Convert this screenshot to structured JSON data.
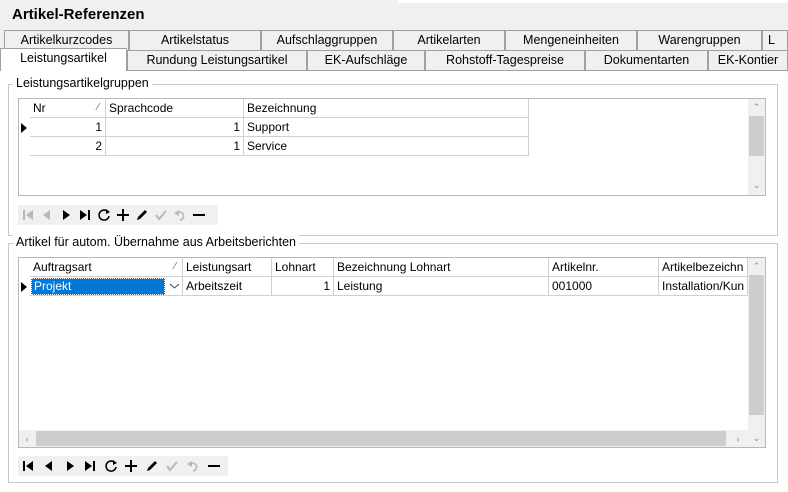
{
  "window": {
    "title": "Artikel-Referenzen"
  },
  "tabs_row1": [
    {
      "label": "Artikelkurzcodes"
    },
    {
      "label": "Artikelstatus"
    },
    {
      "label": "Aufschlaggruppen"
    },
    {
      "label": "Artikelarten"
    },
    {
      "label": "Mengeneinheiten"
    },
    {
      "label": "Warengruppen"
    },
    {
      "label": "L"
    }
  ],
  "tabs_row2": [
    {
      "label": "Leistungsartikel",
      "active": true
    },
    {
      "label": "Rundung Leistungsartikel"
    },
    {
      "label": "EK-Aufschläge"
    },
    {
      "label": "Rohstoff-Tagespreise"
    },
    {
      "label": "Dokumentarten"
    },
    {
      "label": "EK-Kontier"
    }
  ],
  "group1": {
    "title": "Leistungsartikelgruppen",
    "columns": [
      "Nr",
      "Sprachcode",
      "Bezeichnung"
    ],
    "rows": [
      {
        "nr": "1",
        "sprachcode": "1",
        "bezeichnung": "Support"
      },
      {
        "nr": "2",
        "sprachcode": "1",
        "bezeichnung": "Service"
      }
    ]
  },
  "group2": {
    "title": "Artikel für autom. Übernahme aus Arbeitsberichten",
    "columns": [
      "Auftragsart",
      "Leistungsart",
      "Lohnart",
      "Bezeichnung Lohnart",
      "Artikelnr.",
      "Artikelbezeichn"
    ],
    "rows": [
      {
        "auftragsart": "Projekt",
        "leistungsart": "Arbeitszeit",
        "lohnart": "1",
        "bezeichnung_lohnart": "Leistung",
        "artikelnr": "001000",
        "artikelbezeichnung": "Installation/Kun"
      }
    ]
  },
  "navigator_icons": [
    "first-icon",
    "prior-icon",
    "next-icon",
    "last-icon",
    "refresh-icon",
    "insert-icon",
    "edit-icon",
    "post-icon",
    "cancel-icon",
    "delete-icon"
  ]
}
